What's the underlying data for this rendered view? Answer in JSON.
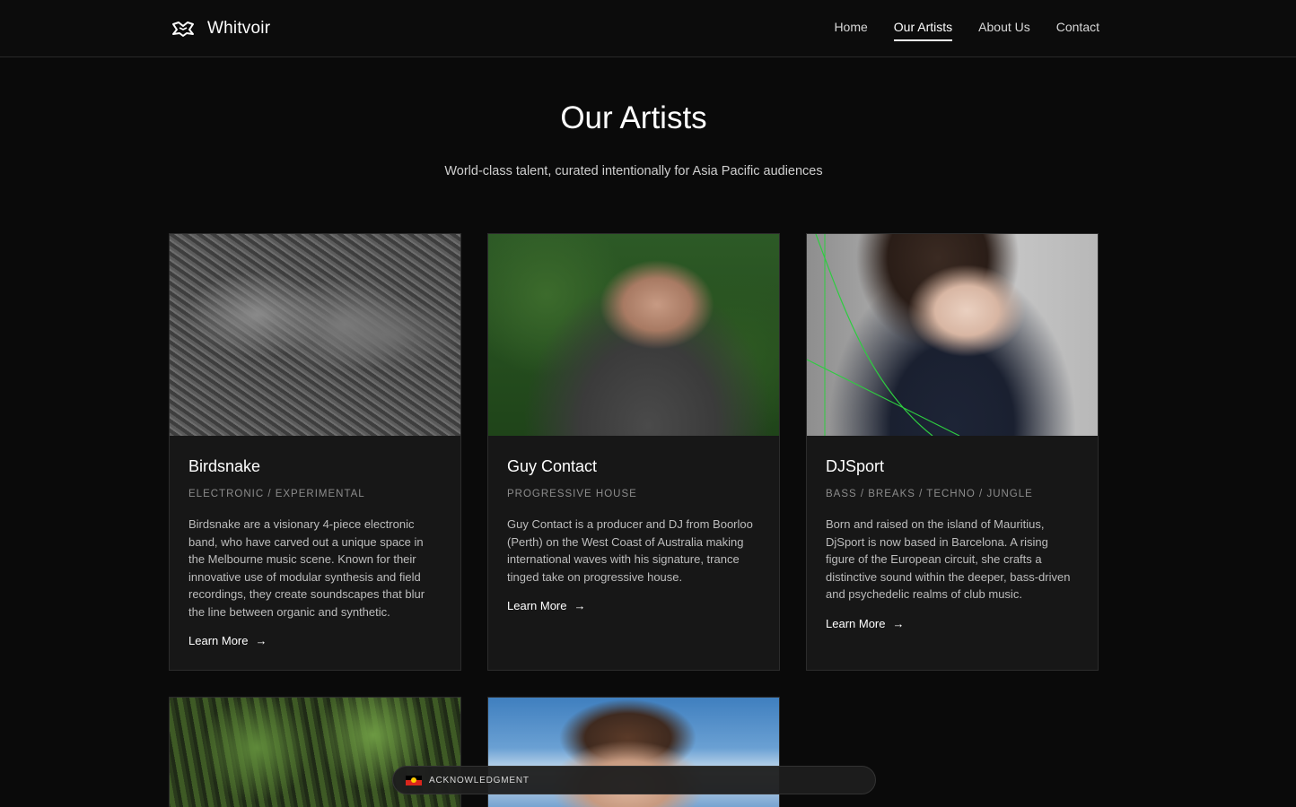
{
  "header": {
    "brand": "Whitvoir",
    "nav": [
      {
        "label": "Home",
        "active": false
      },
      {
        "label": "Our Artists",
        "active": true
      },
      {
        "label": "About Us",
        "active": false
      },
      {
        "label": "Contact",
        "active": false
      }
    ]
  },
  "hero": {
    "title": "Our Artists",
    "subtitle": "World-class talent, curated intentionally for Asia Pacific audiences"
  },
  "artists": [
    {
      "name": "Birdsnake",
      "genre": "ELECTRONIC / EXPERIMENTAL",
      "description": "Birdsnake are a visionary 4-piece electronic band, who have carved out a unique space in the Melbourne music scene. Known for their innovative use of modular synthesis and field recordings, they create soundscapes that blur the line between organic and synthetic.",
      "link_label": "Learn More"
    },
    {
      "name": "Guy Contact",
      "genre": "PROGRESSIVE HOUSE",
      "description": "Guy Contact is a producer and DJ from Boorloo (Perth) on the West Coast of Australia making international waves with his signature, trance tinged take on progressive house.",
      "link_label": "Learn More"
    },
    {
      "name": "DJSport",
      "genre": "BASS / BREAKS / TECHNO / JUNGLE",
      "description": "Born and raised on the island of Mauritius, DjSport is now based in Barcelona. A rising figure of the European circuit, she crafts a distinctive sound within the deeper, bass-driven and psychedelic realms of club music.",
      "link_label": "Learn More"
    }
  ],
  "acknowledgment": {
    "label": "ACKNOWLEDGMENT",
    "icon": "aboriginal-flag-icon"
  },
  "colors": {
    "background": "#0a0a0a",
    "card": "#171717",
    "accent": "#ffffff",
    "muted": "#8c8c8c"
  }
}
